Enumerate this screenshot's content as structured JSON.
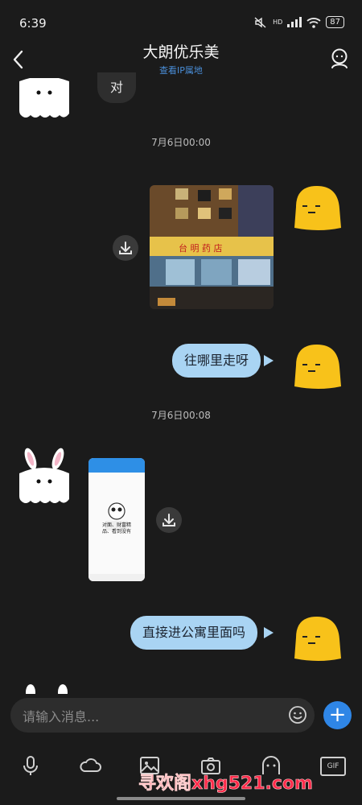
{
  "status": {
    "time": "6:39",
    "battery": "87",
    "network_label": "HD"
  },
  "header": {
    "title": "大朗优乐美",
    "subtitle": "查看IP属地"
  },
  "messages": {
    "reply_dui": "对",
    "ts1": "7月6日00:00",
    "out_text1": "往哪里走呀",
    "ts2": "7月6日00:08",
    "out_text2": "直接进公寓里面吗",
    "screenshot_caption": "对面、财富精品、看到没有"
  },
  "storefront_sign": "台 明 药 店",
  "input": {
    "placeholder": "请输入消息..."
  },
  "plus_label": "+",
  "toolbar": {
    "icons": [
      "microphone-icon",
      "cloud-icon",
      "image-icon",
      "camera-icon",
      "sticker-icon",
      "gif-icon"
    ],
    "gif_label": "GIF"
  },
  "watermark": "寻欢阁xhg521.com",
  "colors": {
    "accent": "#2f86e6",
    "bubble_out": "#a9d4f3",
    "avatar_yellow": "#f8c21a",
    "watermark": "#ff2a4a"
  }
}
